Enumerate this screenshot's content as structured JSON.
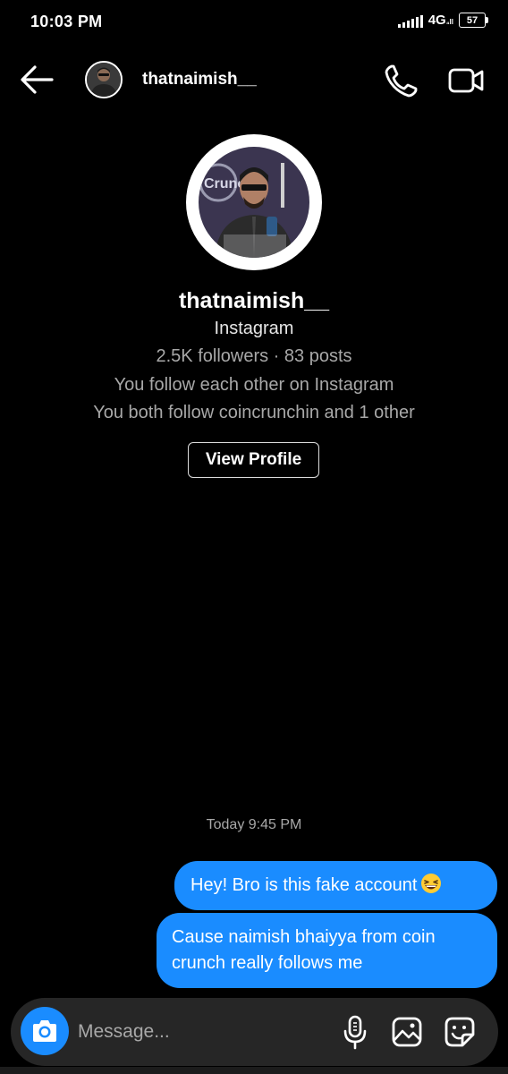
{
  "status_bar": {
    "time": "10:03 PM",
    "network": "4G",
    "network_sub": "₄ll",
    "battery": "57"
  },
  "header": {
    "username": "thatnaimish__",
    "avatar_icon": "profile-photo-icon",
    "back_icon": "arrow-left-icon",
    "call_icon": "phone-icon",
    "video_icon": "video-camera-icon"
  },
  "profile": {
    "name": "thatnaimish__",
    "platform": "Instagram",
    "stats": "2.5K followers · 83 posts",
    "mutual_follow": "You follow each other on Instagram",
    "mutual_friends": "You both follow coincrunchin and 1 other",
    "view_profile_label": "View Profile",
    "avatar_text": "Crunch"
  },
  "messages": {
    "timestamp": "Today 9:45 PM",
    "items": [
      {
        "text": "Hey! Bro is this fake account",
        "emoji": "grinning-squinting-face"
      },
      {
        "text": "Cause naimish bhaiyya from coin crunch really follows me"
      }
    ]
  },
  "composer": {
    "placeholder": "Message...",
    "camera_icon": "camera-icon",
    "mic_icon": "microphone-icon",
    "gallery_icon": "gallery-icon",
    "sticker_icon": "sticker-icon"
  },
  "colors": {
    "background": "#000000",
    "bubble": "#1a8cff",
    "composer": "#262626",
    "muted_text": "#a8a8a8"
  }
}
